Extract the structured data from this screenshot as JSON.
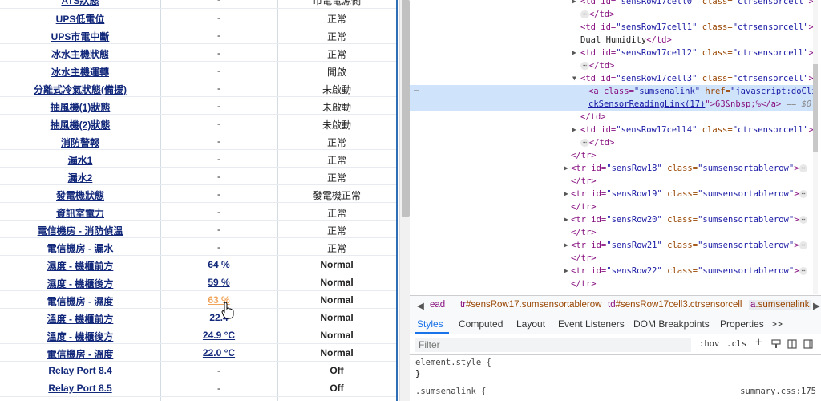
{
  "sensor_table": {
    "top_row_partial": {
      "name": "ATS狀態",
      "value": "-",
      "status": "市電電源側"
    },
    "rows": [
      {
        "name": "UPS低電位",
        "value": "-",
        "status": "正常"
      },
      {
        "name": "UPS市電中斷",
        "value": "-",
        "status": "正常"
      },
      {
        "name": "冰水主機狀態",
        "value": "-",
        "status": "正常"
      },
      {
        "name": "冰水主機運轉",
        "value": "-",
        "status": "開啟"
      },
      {
        "name": "分離式冷氣狀態(備援)",
        "value": "-",
        "status": "未啟動"
      },
      {
        "name": "抽風機(1)狀態",
        "value": "-",
        "status": "未啟動"
      },
      {
        "name": "抽風機(2)狀態",
        "value": "-",
        "status": "未啟動"
      },
      {
        "name": "消防警報",
        "value": "-",
        "status": "正常"
      },
      {
        "name": "漏水1",
        "value": "-",
        "status": "正常"
      },
      {
        "name": "漏水2",
        "value": "-",
        "status": "正常"
      },
      {
        "name": "發電機狀態",
        "value": "-",
        "status": "發電機正常"
      },
      {
        "name": "資訊室電力",
        "value": "-",
        "status": "正常"
      },
      {
        "name": "電信機房 - 消防偵溫",
        "value": "-",
        "status": "正常"
      },
      {
        "name": "電信機房 - 漏水",
        "value": "-",
        "status": "正常"
      },
      {
        "name": "濕度 - 機櫃前方",
        "value": "64 %",
        "status": "Normal"
      },
      {
        "name": "濕度 - 機櫃後方",
        "value": "59 %",
        "status": "Normal"
      },
      {
        "name": "電信機房 - 濕度",
        "value": "63 %",
        "status": "Normal"
      },
      {
        "name": "溫度 - 機櫃前方",
        "value": "22.4",
        "status": "Normal"
      },
      {
        "name": "溫度 - 機櫃後方",
        "value": "24.9 °C",
        "status": "Normal"
      },
      {
        "name": "電信機房 - 溫度",
        "value": "22.0 °C",
        "status": "Normal"
      },
      {
        "name": "Relay Port 8.4",
        "value": "-",
        "status": "Off"
      },
      {
        "name": "Relay Port 8.5",
        "value": "-",
        "status": "Off"
      }
    ]
  },
  "devtools": {
    "lines": {
      "l0": {
        "t1": "<td id=",
        "a1": "\"sensRow17cell0\"",
        "t2": " class=",
        "a2": "\"ctrsensorcell\"",
        "t3": ">"
      },
      "l1": {
        "t": "</td>"
      },
      "l2": {
        "t1": "<td id=",
        "a1": "\"sensRow17cell1\"",
        "t2": " class=",
        "a2": "\"ctrsensorcell\"",
        "t3": ">"
      },
      "l3": {
        "t": "Dual Humidity"
      },
      "l3e": {
        "t": "</td>"
      },
      "l4": {
        "t1": "<td id=",
        "a1": "\"sensRow17cell2\"",
        "t2": " class=",
        "a2": "\"ctrsensorcell\"",
        "t3": ">"
      },
      "l5": {
        "t": "</td>"
      },
      "l6": {
        "t1": "<td id=",
        "a1": "\"sensRow17cell3\"",
        "t2": " class=",
        "a2": "\"ctrsensorcell\"",
        "t3": ">"
      },
      "l7": {
        "t1": "<a class=",
        "a1": "\"sumsenalink\"",
        "t2": " href=",
        "link1": "javascript:doCli"
      },
      "l8": {
        "link2": "ckSensorReadingLink(17)",
        "t1": "\">63&nbsp;%</a>",
        "eq": " == $0"
      },
      "l9": {
        "t": "</td>"
      },
      "l10": {
        "t1": "<td id=",
        "a1": "\"sensRow17cell4\"",
        "t2": " class=",
        "a2": "\"ctrsensorcell\"",
        "t3": ">"
      },
      "l11": {
        "t": "</td>"
      },
      "l12": {
        "t": "</tr>"
      },
      "rows": [
        {
          "t1": "<tr id=",
          "a1": "\"sensRow18\"",
          "t2": " class=",
          "a2": "\"sumsensortablerow\"",
          "t3": ">"
        },
        {
          "t1": "<tr id=",
          "a1": "\"sensRow19\"",
          "t2": " class=",
          "a2": "\"sumsensortablerow\"",
          "t3": ">"
        },
        {
          "t1": "<tr id=",
          "a1": "\"sensRow20\"",
          "t2": " class=",
          "a2": "\"sumsensortablerow\"",
          "t3": ">"
        },
        {
          "t1": "<tr id=",
          "a1": "\"sensRow21\"",
          "t2": " class=",
          "a2": "\"sumsensortablerow\"",
          "t3": ">"
        },
        {
          "t1": "<tr id=",
          "a1": "\"sensRow22\"",
          "t2": " class=",
          "a2": "\"sumsensortablerow\"",
          "t3": ">"
        }
      ],
      "tr_close": "</tr>",
      "ellipsis": "⋯"
    },
    "breadcrumbs": {
      "b0": "ead",
      "b1a": "tr",
      "b1b": "#sensRow17",
      "b1c": ".sumsensortablerow",
      "b2a": "td",
      "b2b": "#sensRow17cell3",
      "b2c": ".ctrsensorcell",
      "b3a": "a",
      "b3b": ".sumsenalink"
    },
    "tabs": {
      "styles": "Styles",
      "computed": "Computed",
      "layout": "Layout",
      "event_listeners": "Event Listeners",
      "dom_breakpoints": "DOM Breakpoints",
      "properties": "Properties",
      "more": ">>"
    },
    "filter": {
      "placeholder": "Filter",
      "hov": ":hov",
      "cls": ".cls",
      "plus": "+"
    },
    "styles": {
      "element_style": "element.style {",
      "close_brace": "}",
      "rule_selector": ".sumsenalink {",
      "source": "summary.css:175"
    }
  }
}
